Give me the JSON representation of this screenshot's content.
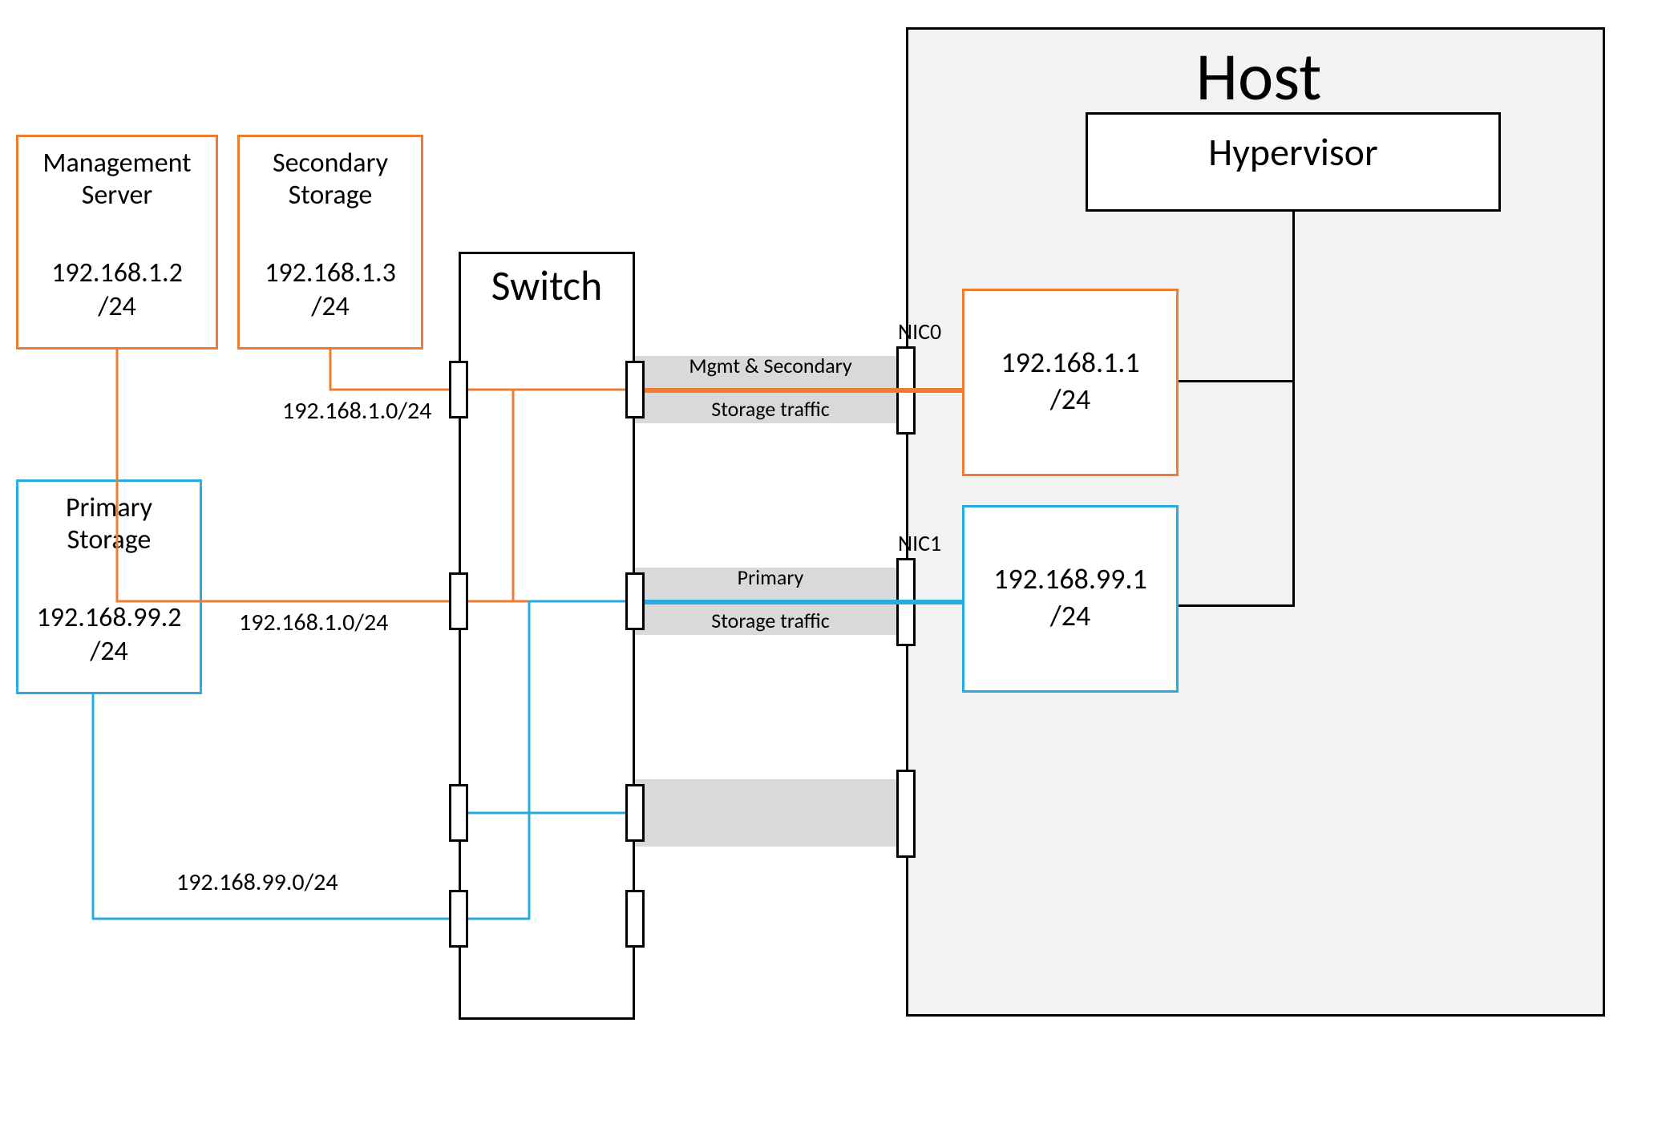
{
  "host": {
    "title": "Host",
    "hypervisor": "Hypervisor",
    "nic0": {
      "label": "NIC0",
      "ip": "192.168.1.1",
      "mask": "/24"
    },
    "nic1": {
      "label": "NIC1",
      "ip": "192.168.99.1",
      "mask": "/24"
    }
  },
  "switch": {
    "title": "Switch"
  },
  "mgmt": {
    "title": "Management\nServer",
    "ip": "192.168.1.2",
    "mask": "/24"
  },
  "secondary": {
    "title": "Secondary\nStorage",
    "ip": "192.168.1.3",
    "mask": "/24"
  },
  "primary": {
    "title": "Primary\nStorage",
    "ip": "192.168.99.2",
    "mask": "/24"
  },
  "links": {
    "mgmt_net": "192.168.1.0/24",
    "sec_net": "192.168.1.0/24",
    "primary_net": "192.168.99.0/24",
    "mgmt_traffic_l1": "Mgmt & Secondary",
    "mgmt_traffic_l2": "Storage traffic",
    "primary_traffic_l1": "Primary",
    "primary_traffic_l2": "Storage traffic"
  },
  "colors": {
    "orange": "#ed7d31",
    "blue": "#29abe2",
    "grey": "#d9d9d9"
  }
}
